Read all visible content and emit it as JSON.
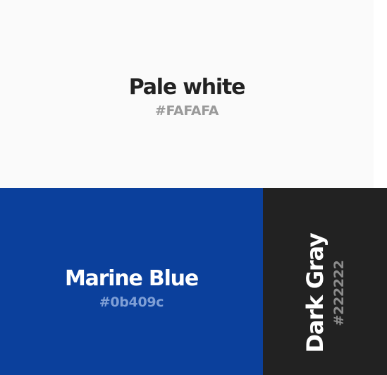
{
  "swatches": {
    "pale": {
      "name": "Pale white",
      "hex": "#FAFAFA",
      "color": "#FAFAFA"
    },
    "blue": {
      "name": "Marine Blue",
      "hex": "#0b409c",
      "color": "#0b409c"
    },
    "dark": {
      "name": "Dark Gray",
      "hex": "#222222",
      "color": "#222222"
    }
  }
}
